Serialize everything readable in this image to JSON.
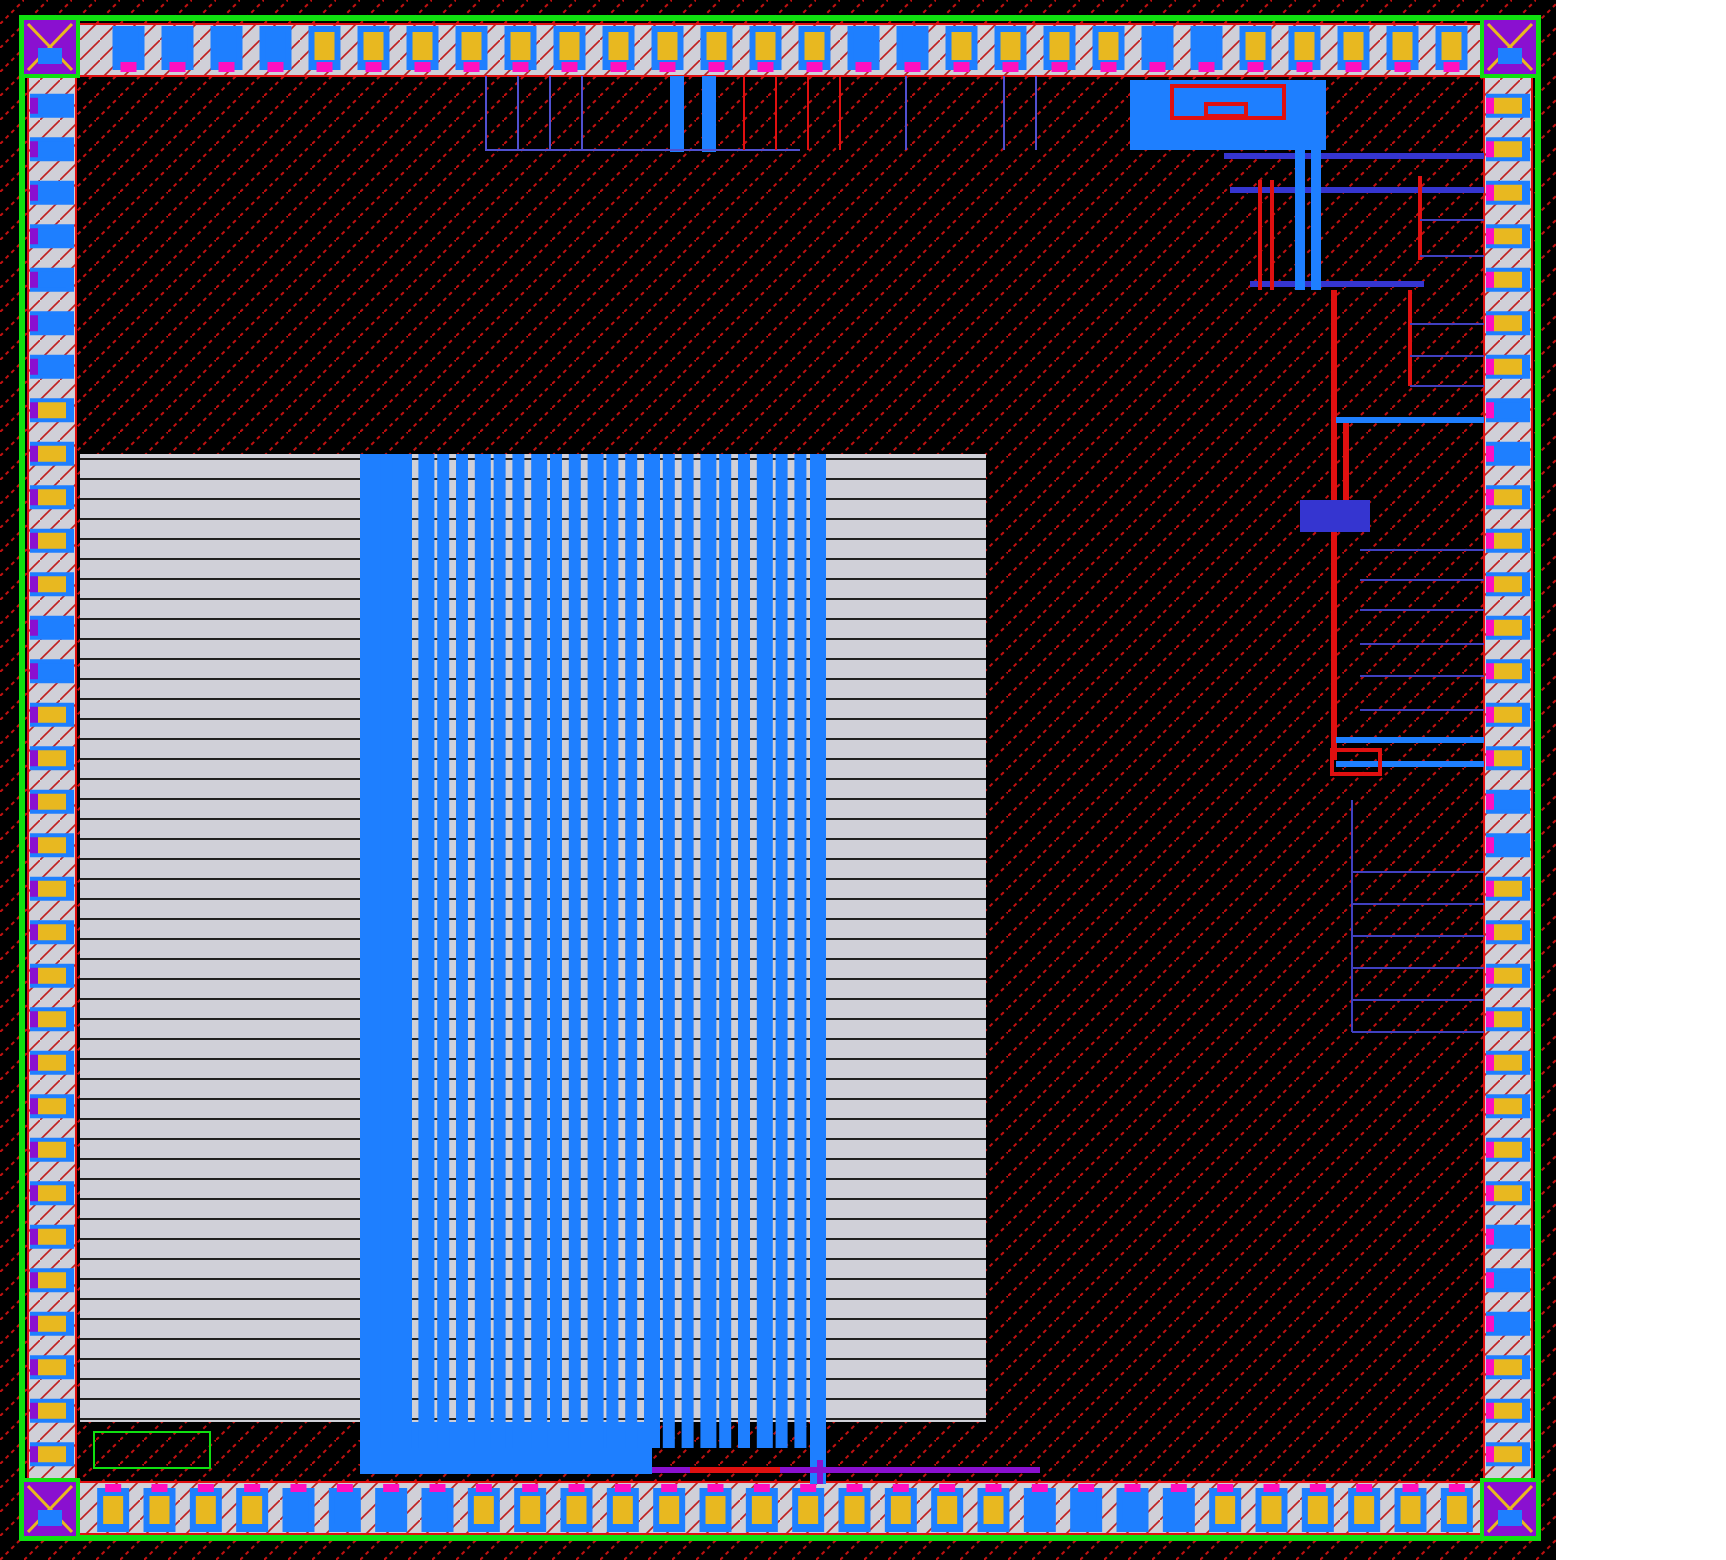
{
  "pad_ring": {
    "top": [
      {
        "kind": "power"
      },
      {
        "kind": "power"
      },
      {
        "kind": "power"
      },
      {
        "kind": "power"
      },
      {
        "kind": "signal"
      },
      {
        "kind": "signal"
      },
      {
        "kind": "signal"
      },
      {
        "kind": "signal"
      },
      {
        "kind": "signal"
      },
      {
        "kind": "signal"
      },
      {
        "kind": "signal"
      },
      {
        "kind": "signal"
      },
      {
        "kind": "signal"
      },
      {
        "kind": "signal"
      },
      {
        "kind": "signal"
      },
      {
        "kind": "power"
      },
      {
        "kind": "power"
      },
      {
        "kind": "signal"
      },
      {
        "kind": "signal"
      },
      {
        "kind": "signal"
      },
      {
        "kind": "signal"
      },
      {
        "kind": "power"
      },
      {
        "kind": "power"
      },
      {
        "kind": "signal"
      },
      {
        "kind": "signal"
      },
      {
        "kind": "signal"
      },
      {
        "kind": "signal"
      },
      {
        "kind": "signal"
      }
    ],
    "bottom": [
      {
        "kind": "signal"
      },
      {
        "kind": "signal"
      },
      {
        "kind": "signal"
      },
      {
        "kind": "signal"
      },
      {
        "kind": "power"
      },
      {
        "kind": "power"
      },
      {
        "kind": "power"
      },
      {
        "kind": "power"
      },
      {
        "kind": "signal"
      },
      {
        "kind": "signal"
      },
      {
        "kind": "signal"
      },
      {
        "kind": "signal"
      },
      {
        "kind": "signal"
      },
      {
        "kind": "signal"
      },
      {
        "kind": "signal"
      },
      {
        "kind": "signal"
      },
      {
        "kind": "signal"
      },
      {
        "kind": "signal"
      },
      {
        "kind": "signal"
      },
      {
        "kind": "signal"
      },
      {
        "kind": "power"
      },
      {
        "kind": "power"
      },
      {
        "kind": "power"
      },
      {
        "kind": "power"
      },
      {
        "kind": "signal"
      },
      {
        "kind": "signal"
      },
      {
        "kind": "signal"
      },
      {
        "kind": "signal"
      },
      {
        "kind": "signal"
      },
      {
        "kind": "signal"
      }
    ],
    "left": [
      {
        "kind": "power"
      },
      {
        "kind": "power"
      },
      {
        "kind": "power"
      },
      {
        "kind": "power"
      },
      {
        "kind": "power"
      },
      {
        "kind": "power"
      },
      {
        "kind": "power"
      },
      {
        "kind": "signal"
      },
      {
        "kind": "signal"
      },
      {
        "kind": "signal"
      },
      {
        "kind": "signal"
      },
      {
        "kind": "signal"
      },
      {
        "kind": "power"
      },
      {
        "kind": "power"
      },
      {
        "kind": "signal"
      },
      {
        "kind": "signal"
      },
      {
        "kind": "signal"
      },
      {
        "kind": "signal"
      },
      {
        "kind": "signal"
      },
      {
        "kind": "signal"
      },
      {
        "kind": "signal"
      },
      {
        "kind": "signal"
      },
      {
        "kind": "signal"
      },
      {
        "kind": "signal"
      },
      {
        "kind": "signal"
      },
      {
        "kind": "signal"
      },
      {
        "kind": "signal"
      },
      {
        "kind": "signal"
      },
      {
        "kind": "signal"
      },
      {
        "kind": "signal"
      },
      {
        "kind": "signal"
      },
      {
        "kind": "signal"
      }
    ],
    "right": [
      {
        "kind": "signal"
      },
      {
        "kind": "signal"
      },
      {
        "kind": "signal"
      },
      {
        "kind": "signal"
      },
      {
        "kind": "signal"
      },
      {
        "kind": "signal"
      },
      {
        "kind": "signal"
      },
      {
        "kind": "power"
      },
      {
        "kind": "power"
      },
      {
        "kind": "signal"
      },
      {
        "kind": "signal"
      },
      {
        "kind": "signal"
      },
      {
        "kind": "signal"
      },
      {
        "kind": "signal"
      },
      {
        "kind": "signal"
      },
      {
        "kind": "signal"
      },
      {
        "kind": "power"
      },
      {
        "kind": "power"
      },
      {
        "kind": "signal"
      },
      {
        "kind": "signal"
      },
      {
        "kind": "signal"
      },
      {
        "kind": "signal"
      },
      {
        "kind": "signal"
      },
      {
        "kind": "signal"
      },
      {
        "kind": "signal"
      },
      {
        "kind": "signal"
      },
      {
        "kind": "power"
      },
      {
        "kind": "power"
      },
      {
        "kind": "power"
      },
      {
        "kind": "signal"
      },
      {
        "kind": "signal"
      },
      {
        "kind": "signal"
      }
    ]
  }
}
